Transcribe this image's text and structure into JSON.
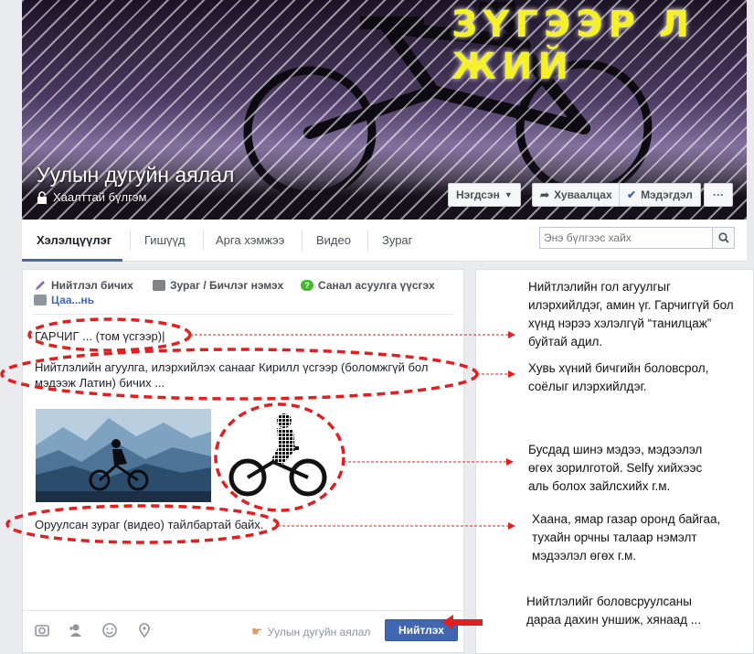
{
  "cover": {
    "title": "ЗҮГЭЭР Л ЖИЙ",
    "group_name": "Уулын дугуйн аялал",
    "privacy": "Хаалттай бүлгэм",
    "buttons": {
      "joined": "Нэгдсэн",
      "share": "Хуваалцах",
      "notifications": "Мэдэгдэл",
      "more": "···"
    }
  },
  "tabs": [
    {
      "label": "Хэлэлцүүлэг"
    },
    {
      "label": "Гишүүд"
    },
    {
      "label": "Арга хэмжээ"
    },
    {
      "label": "Видео"
    },
    {
      "label": "Зураг"
    }
  ],
  "search": {
    "placeholder": "Энэ бүлгээс хайх"
  },
  "composer": {
    "toolbar": {
      "write_post": "Нийтлэл бичих",
      "add_photo": "Зураг / Бичлэг нэмэх",
      "create_poll": "Санал асуулга үүсгэх",
      "more": "Цаа...нь"
    },
    "title_text": "ГАРЧИГ ... (том үсгээр)|",
    "body_text": "Нийтлэлийн агуулга, илэрхийлэх санааг Кирилл үсгээр (боломжгүй бол мэдээж Латин) бичих ...",
    "caption_text": "Оруулсан зураг (видео) тайлбартай байх.",
    "footer": {
      "posting_as": "Уулын дугуйн аялал",
      "post_button": "Нийтлэх"
    }
  },
  "notes": {
    "n1": "Нийтлэлийн гол агуулгыг илэрхийлдэг, амин үг. Гарчиггүй бол хүнд нэрээ хэлэлгүй “танилцаж” буйтай адил.",
    "n2": "Хувь хүний бичгийн боловсрол, соёлыг илэрхийлдэг.",
    "n3": "Бусдад шинэ мэдээ, мэдээлэл өгөх зорилготой. Selfy хийхээс аль болох зайлсхийх г.м.",
    "n4": "Хаана, ямар газар оронд байгаа, тухайн орчны талаар нэмэлт мэдээлэл өгөх г.м.",
    "n5": "Нийтлэлийг боловсруулсаны дараа дахин уншиж, хянаад ..."
  },
  "colors": {
    "accent": "#4267b2",
    "annotation": "#e02020",
    "title_yellow": "#f5f028"
  }
}
